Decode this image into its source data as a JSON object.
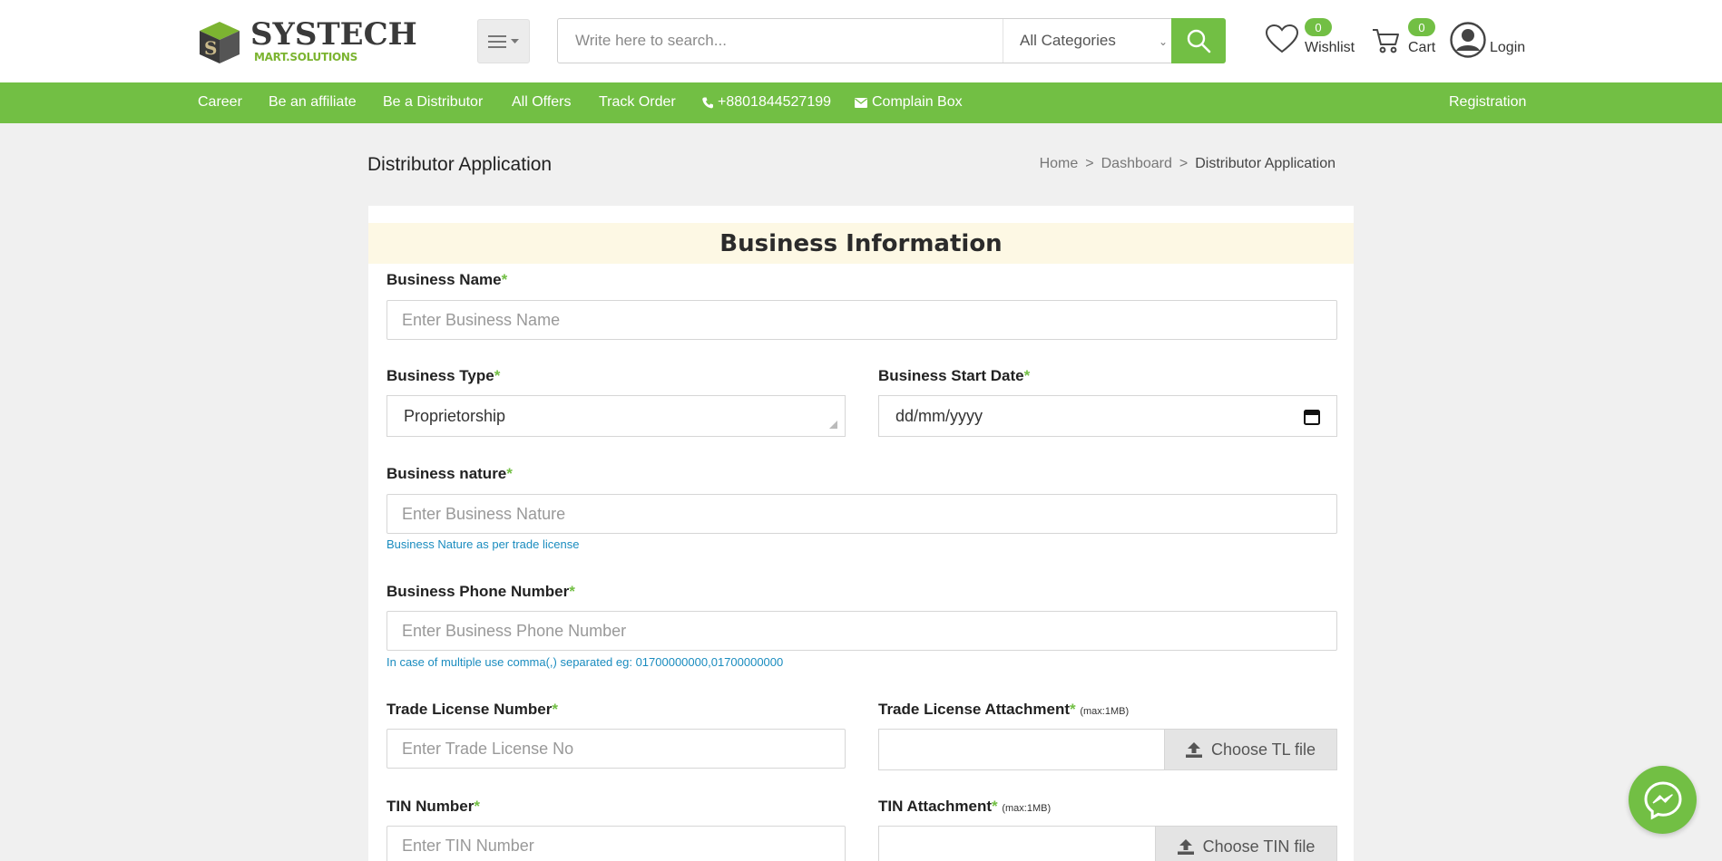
{
  "header": {
    "logo_main": "SYSTECH",
    "logo_sub": "MART.SOLUTIONS",
    "search_placeholder": "Write here to search...",
    "category_selected": "All Categories",
    "wishlist_label": "Wishlist",
    "wishlist_count": "0",
    "cart_label": "Cart",
    "cart_count": "0",
    "login_label": "Login"
  },
  "nav": {
    "items": [
      "Career",
      "Be an affiliate",
      "Be a Distributor",
      "All Offers",
      "Track Order"
    ],
    "phone": "+8801844527199",
    "complain": "Complain Box",
    "registration": "Registration"
  },
  "page": {
    "title": "Distributor Application",
    "breadcrumb": [
      "Home",
      "Dashboard",
      "Distributor Application"
    ],
    "breadcrumb_sep": ">"
  },
  "form": {
    "section_title": "Business Information",
    "required_mark": "*",
    "business_name_label": "Business Name",
    "business_name_placeholder": "Enter Business Name",
    "business_type_label": "Business Type",
    "business_type_value": "Proprietorship",
    "business_start_label": "Business Start Date",
    "business_start_value": "dd/mm/yyyy",
    "business_nature_label": "Business nature",
    "business_nature_placeholder": "Enter Business Nature",
    "business_nature_hint": "Business Nature as per trade license",
    "phone_label": "Business Phone Number",
    "phone_placeholder": "Enter Business Phone Number",
    "phone_hint": "In case of multiple use comma(,) separated eg: 01700000000,01700000000",
    "tl_label": "Trade License Number",
    "tl_placeholder": "Enter Trade License No",
    "tl_attach_label": "Trade License Attachment",
    "max_size": "(max:1MB)",
    "tl_file_button": "Choose TL file",
    "tin_label": "TIN Number",
    "tin_placeholder": "Enter TIN Number",
    "tin_attach_label": "TIN Attachment",
    "tin_file_button": "Choose TIN file"
  },
  "colors": {
    "brand_green": "#72bf44",
    "section_bg": "#fdf8e4",
    "hint_blue": "#1a8cbf"
  },
  "icons": [
    "menu-icon",
    "search-icon",
    "heart-icon",
    "cart-icon",
    "user-icon",
    "phone-icon",
    "envelope-icon",
    "calendar-icon",
    "upload-icon",
    "messenger-icon"
  ]
}
